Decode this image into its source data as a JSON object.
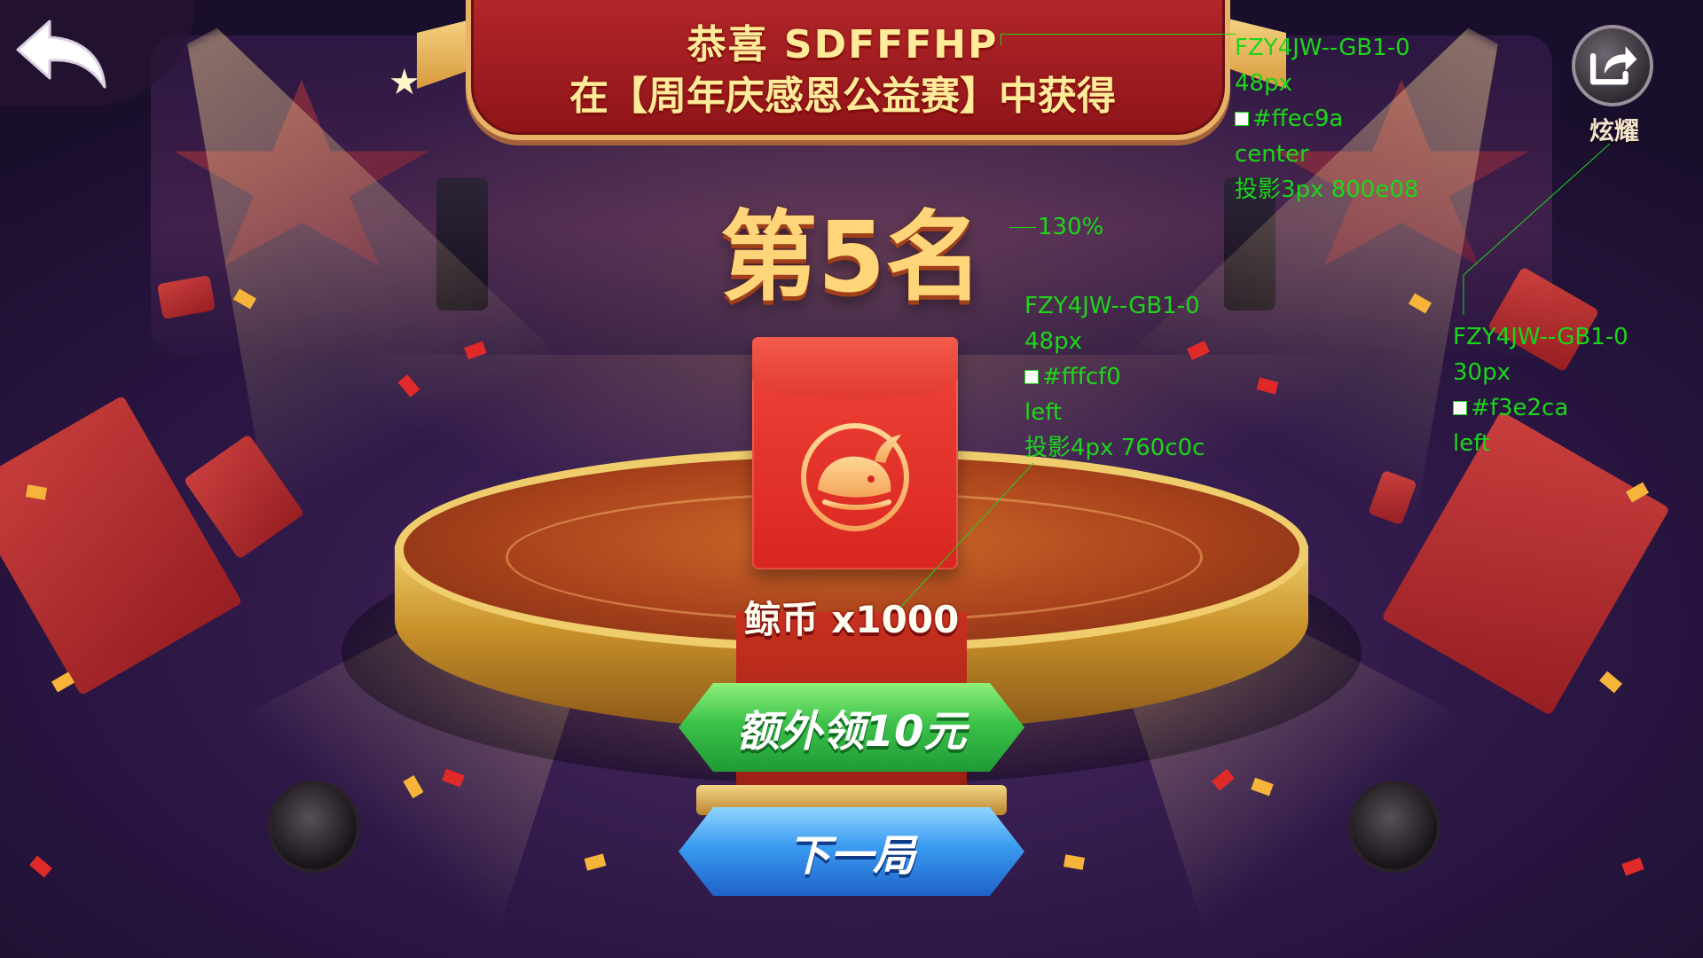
{
  "banner": {
    "line1": "恭喜  SDFFFHP",
    "line2": "在【周年庆感恩公益赛】中获得"
  },
  "rank": {
    "label": "第5名"
  },
  "reward": {
    "label": "鲸币 x1000"
  },
  "buttons": {
    "extra": "额外领10元",
    "next": "下一局"
  },
  "share": {
    "label": "炫耀"
  },
  "annotations": {
    "title": {
      "font": "FZY4JW--GB1-0",
      "size": "48px",
      "color": "#ffec9a",
      "align": "center",
      "shadow": "投影3px 800e08"
    },
    "rank": {
      "scale": "130%"
    },
    "reward": {
      "font": "FZY4JW--GB1-0",
      "size": "48px",
      "color": "#fffcf0",
      "align": "left",
      "shadow": "投影4px 760c0c"
    },
    "share": {
      "font": "FZY4JW--GB1-0",
      "size": "30px",
      "color": "#f3e2ca",
      "align": "left"
    }
  },
  "colors": {
    "banner_text": "#ffec9a",
    "reward_text": "#fffcf0",
    "share_text": "#f3e2ca",
    "annotation": "#1cd61a"
  }
}
